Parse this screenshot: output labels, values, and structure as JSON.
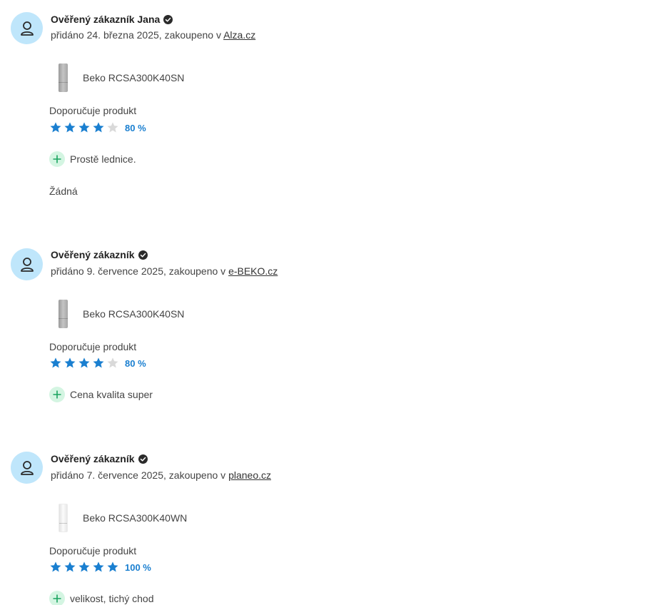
{
  "colors": {
    "avatar_bg": "#bfe6fb",
    "star_filled": "#1a7fd0",
    "star_empty": "#d9d9d9",
    "plus_bg": "#d4f5e2",
    "plus_fg": "#1aa35f"
  },
  "reviews": [
    {
      "author": "Ověřený zákazník Jana",
      "added_prefix": "přidáno 24. března 2025, zakoupeno v ",
      "shop": "Alza.cz",
      "product": "Beko RCSA300K40SN",
      "product_image": "fridge-silver",
      "recommend": "Doporučuje produkt",
      "stars": 4,
      "percent": "80 %",
      "pro": "Prostě lednice.",
      "con": "Žádná"
    },
    {
      "author": "Ověřený zákazník",
      "added_prefix": "přidáno 9. července 2025, zakoupeno v ",
      "shop": "e-BEKO.cz",
      "product": "Beko RCSA300K40SN",
      "product_image": "fridge-silver",
      "recommend": "Doporučuje produkt",
      "stars": 4,
      "percent": "80 %",
      "pro": "Cena kvalita super"
    },
    {
      "author": "Ověřený zákazník",
      "added_prefix": "přidáno 7. července 2025, zakoupeno v ",
      "shop": "planeo.cz",
      "product": "Beko RCSA300K40WN",
      "product_image": "fridge-white",
      "recommend": "Doporučuje produkt",
      "stars": 5,
      "percent": "100 %",
      "pro": "velikost, tichý chod"
    }
  ]
}
